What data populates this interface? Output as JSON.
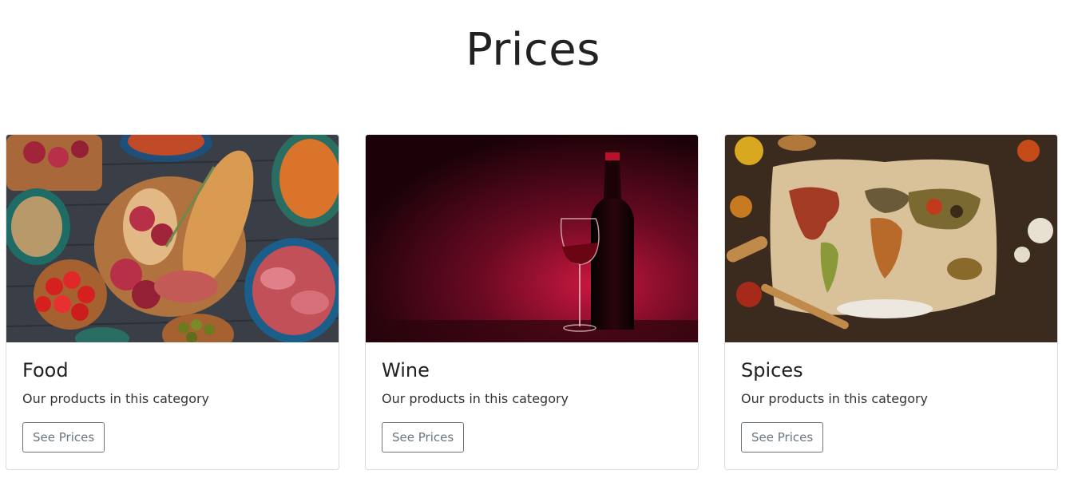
{
  "page": {
    "title": "Prices"
  },
  "cards": [
    {
      "title": "Food",
      "text": "Our products in this category",
      "button": "See Prices"
    },
    {
      "title": "Wine",
      "text": "Our products in this category",
      "button": "See Prices"
    },
    {
      "title": "Spices",
      "text": "Our products in this category",
      "button": "See Prices"
    }
  ],
  "colors": {
    "border": "#dcdcdc",
    "button_outline": "#6c757d",
    "title_text": "#222222"
  }
}
